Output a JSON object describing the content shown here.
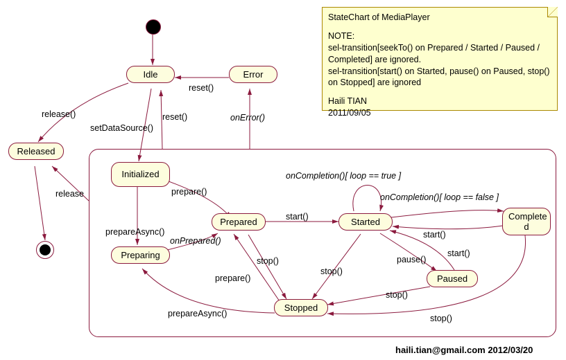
{
  "chart_data": {
    "type": "statechart",
    "title": "StateChart of MediaPlayer",
    "states": [
      {
        "id": "initial_top",
        "kind": "initial"
      },
      {
        "id": "final_left",
        "kind": "final"
      },
      {
        "id": "Idle",
        "kind": "state"
      },
      {
        "id": "Error",
        "kind": "state"
      },
      {
        "id": "Released",
        "kind": "state"
      },
      {
        "id": "Composite",
        "kind": "composite",
        "children": [
          "Initialized",
          "Preparing",
          "Prepared",
          "Started",
          "Paused",
          "Stopped",
          "Completed"
        ]
      },
      {
        "id": "Initialized",
        "kind": "state"
      },
      {
        "id": "Preparing",
        "kind": "state"
      },
      {
        "id": "Prepared",
        "kind": "state"
      },
      {
        "id": "Started",
        "kind": "state"
      },
      {
        "id": "Paused",
        "kind": "state"
      },
      {
        "id": "Stopped",
        "kind": "state"
      },
      {
        "id": "Completed",
        "kind": "state"
      }
    ],
    "transitions": [
      {
        "from": "initial_top",
        "to": "Idle",
        "label": ""
      },
      {
        "from": "Idle",
        "to": "Released",
        "label": "release()"
      },
      {
        "from": "Idle",
        "to": "Initialized",
        "label": "setDataSource()"
      },
      {
        "from": "Error",
        "to": "Idle",
        "label": "reset()"
      },
      {
        "from": "Composite",
        "to": "Idle",
        "label": "reset()"
      },
      {
        "from": "Composite",
        "to": "Released",
        "label": "release"
      },
      {
        "from": "Composite",
        "to": "Error",
        "label": "onError()",
        "style": "italic"
      },
      {
        "from": "Released",
        "to": "final_left",
        "label": ""
      },
      {
        "from": "Initialized",
        "to": "Prepared",
        "label": "prepare()"
      },
      {
        "from": "Initialized",
        "to": "Preparing",
        "label": "prepareAsync()"
      },
      {
        "from": "Preparing",
        "to": "Prepared",
        "label": "onPrepared()",
        "style": "italic"
      },
      {
        "from": "Prepared",
        "to": "Started",
        "label": "start()"
      },
      {
        "from": "Started",
        "to": "Started",
        "label": "onCompletion()[ loop == true ]",
        "style": "italic",
        "selfloop": true
      },
      {
        "from": "Started",
        "to": "Completed",
        "label": "onCompletion()[ loop == false ]",
        "style": "italic"
      },
      {
        "from": "Completed",
        "to": "Started",
        "label": "start()"
      },
      {
        "from": "Started",
        "to": "Paused",
        "label": "pause()"
      },
      {
        "from": "Paused",
        "to": "Started",
        "label": "start()"
      },
      {
        "from": "Started",
        "to": "Stopped",
        "label": "stop()"
      },
      {
        "from": "Prepared",
        "to": "Stopped",
        "label": "stop()"
      },
      {
        "from": "Paused",
        "to": "Stopped",
        "label": "stop()"
      },
      {
        "from": "Completed",
        "to": "Stopped",
        "label": "stop()"
      },
      {
        "from": "Stopped",
        "to": "Prepared",
        "label": "prepare()"
      },
      {
        "from": "Stopped",
        "to": "Preparing",
        "label": "prepareAsync()"
      }
    ]
  },
  "states": {
    "Idle": "Idle",
    "Error": "Error",
    "Released": "Released",
    "Initialized": "Initialized",
    "Preparing": "Preparing",
    "Prepared": "Prepared",
    "Started": "Started",
    "Paused": "Paused",
    "Stopped": "Stopped",
    "Completed": "Complete\nd"
  },
  "labels": {
    "release": "release()",
    "releaseShort": "release",
    "setDataSource": "setDataSource()",
    "reset1": "reset()",
    "reset2": "reset()",
    "onError": "onError()",
    "prepare1": "prepare()",
    "prepare2": "prepare()",
    "prepareAsync1": "prepareAsync()",
    "prepareAsync2": "prepareAsync()",
    "onPrepared": "onPrepared()",
    "start1": "start()",
    "start2": "start()",
    "start3": "start()",
    "stop1": "stop()",
    "stop2": "stop()",
    "stop3": "stop()",
    "stop4": "stop()",
    "pause": "pause()",
    "onCompTrue": "onCompletion()[ loop == true ]",
    "onCompFalse": "onCompletion()[ loop == false ]"
  },
  "note": {
    "title": "StateChart of MediaPlayer",
    "noteHdr": "NOTE:",
    "line1": " sel-transition[seekTo() on Prepared / Started / Paused / Completed] are ignored.",
    "line2": " sel-transition[start() on Started, pause() on Paused, stop() on Stopped] are ignored",
    "author": "Haili TIAN",
    "date": "2011/09/05"
  },
  "footer": "haili.tian@gmail.com 2012/03/20"
}
